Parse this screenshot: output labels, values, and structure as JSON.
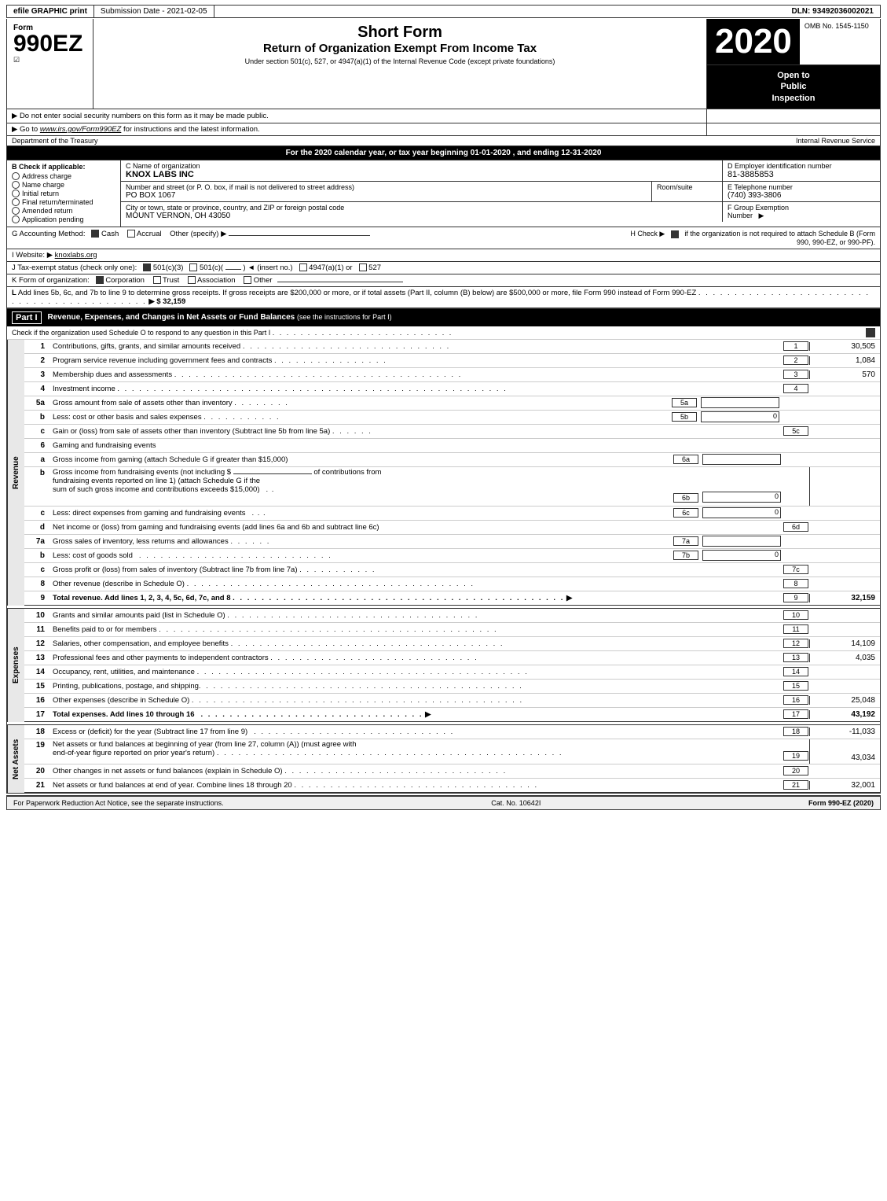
{
  "topBar": {
    "efile": "efile GRAPHIC print",
    "submission": "Submission Date - 2021-02-05",
    "dln": "DLN: 93492036002021"
  },
  "header": {
    "formLabel": "Form",
    "formNumber": "990EZ",
    "titleMain": "Short Form",
    "titleSub": "Return of Organization Exempt From Income Tax",
    "titleUnder": "Under section 501(c), 527, or 4947(a)(1) of the Internal Revenue Code (except private foundations)",
    "notice1": "▶ Do not enter social security numbers on this form as it may be made public.",
    "notice2": "▶ Go to www.irs.gov/Form990EZ for instructions and the latest information.",
    "year": "2020",
    "ombLabel": "OMB No. 1545-1150",
    "openToPublic": "Open to Public Inspection"
  },
  "deptRow": {
    "dept": "Department of the Treasury",
    "irs": "Internal Revenue Service"
  },
  "taxYearRow": "For the 2020 calendar year, or tax year beginning 01-01-2020 , and ending 12-31-2020",
  "checkApplicable": {
    "label": "B Check if applicable:",
    "items": [
      {
        "id": "address-change",
        "text": "Address charge",
        "checked": false
      },
      {
        "id": "name-change",
        "text": "Name charge",
        "checked": false
      },
      {
        "id": "initial-return",
        "text": "Initial return",
        "checked": false
      },
      {
        "id": "final-return",
        "text": "Final return/terminated",
        "checked": false
      },
      {
        "id": "amended",
        "text": "Amended return",
        "checked": false
      },
      {
        "id": "app-pending",
        "text": "Application pending",
        "checked": false
      }
    ]
  },
  "orgInfo": {
    "nameLabel": "C Name of organization",
    "nameValue": "KNOX LABS INC",
    "einLabel": "D Employer identification number",
    "einValue": "81-3885853",
    "addressLabel": "Number and street (or P. O. box, if mail is not delivered to street address)",
    "addressValue": "PO BOX 1067",
    "roomLabel": "Room/suite",
    "roomValue": "",
    "phoneLabel": "E Telephone number",
    "phoneValue": "(740) 393-3806",
    "cityLabel": "City or town, state or province, country, and ZIP or foreign postal code",
    "cityValue": "MOUNT VERNON, OH  43050",
    "groupLabel": "F Group Exemption Number",
    "groupArrow": "▶"
  },
  "accounting": {
    "lineG": "G Accounting Method:",
    "cash": "Cash",
    "cashChecked": true,
    "accrual": "Accrual",
    "accrualChecked": false,
    "other": "Other (specify) ▶",
    "lineH": "H Check ▶",
    "hText": "if the organization is not required to attach Schedule B (Form 990, 990-EZ, or 990-PF).",
    "hChecked": true
  },
  "website": {
    "label": "I Website: ▶",
    "value": "knoxlabs.org"
  },
  "taxExempt": {
    "label": "J Tax-exempt status (check only one):",
    "options": [
      {
        "text": "501(c)(3)",
        "checked": true
      },
      {
        "text": "501(c)(",
        "checked": false
      },
      {
        "text": ") ◄ (insert no.)",
        "checked": false
      },
      {
        "text": "4947(a)(1) or",
        "checked": false
      },
      {
        "text": "527",
        "checked": false
      }
    ]
  },
  "formOrg": {
    "label": "K Form of organization:",
    "options": [
      {
        "text": "Corporation",
        "checked": true
      },
      {
        "text": "Trust",
        "checked": false
      },
      {
        "text": "Association",
        "checked": false
      },
      {
        "text": "Other",
        "checked": false
      }
    ]
  },
  "lineL": {
    "text": "L Add lines 5b, 6c, and 7b to line 9 to determine gross receipts. If gross receipts are $200,000 or more, or if total assets (Part II, column (B) below) are $500,000 or more, file Form 990 instead of Form 990-EZ",
    "dots": ". . . . . . . . . . . . . . . . . . . . . . . . . . . . . . . . . . . . . . . . . .",
    "arrowAmount": "▶ $ 32,159"
  },
  "partI": {
    "label": "Part I",
    "title": "Revenue, Expenses, and Changes in Net Assets or Fund Balances",
    "titleNote": "(see the instructions for Part I)",
    "scheduleONote": "Check if the organization used Schedule O to respond to any question in this Part I",
    "scheduleODots": ". . . . . . . . . . . . . . . . . . . . . . . . . .",
    "scheduleOChecked": true,
    "rows": [
      {
        "num": "1",
        "desc": "Contributions, gifts, grants, and similar amounts received",
        "dots": ". . . . . . . . . . . . . . . . . . . . . . . . . . . . .",
        "ref": "1",
        "amount": "30,505"
      },
      {
        "num": "2",
        "desc": "Program service revenue including government fees and contracts",
        "dots": ". . . . . . . . . . . . . . . .",
        "ref": "2",
        "amount": "1,084"
      },
      {
        "num": "3",
        "desc": "Membership dues and assessments",
        "dots": ". . . . . . . . . . . . . . . . . . . . . . . . . . . . . . . . . . . . . . . .",
        "ref": "3",
        "amount": "570"
      },
      {
        "num": "4",
        "desc": "Investment income",
        "dots": ". . . . . . . . . . . . . . . . . . . . . . . . . . . . . . . . . . . . . . . . . . . . . . . . . . . . . .",
        "ref": "4",
        "amount": ""
      },
      {
        "num": "5a",
        "desc": "Gross amount from sale of assets other than inventory",
        "dots": ". . . . . . . .",
        "subLabel": "5a",
        "subAmount": "",
        "ref": "",
        "amount": ""
      },
      {
        "num": "b",
        "desc": "Less: cost or other basis and sales expenses",
        "dots": ". . . . . . . . . . .",
        "subLabel": "5b",
        "subAmount": "0",
        "ref": "",
        "amount": ""
      },
      {
        "num": "c",
        "desc": "Gain or (loss) from sale of assets other than inventory (Subtract line 5b from line 5a)",
        "dots": ". . . . . .",
        "ref": "5c",
        "amount": ""
      }
    ],
    "line6": {
      "num": "6",
      "desc": "Gaming and fundraising events"
    },
    "line6a": {
      "num": "a",
      "desc": "Gross income from gaming (attach Schedule G if greater than $15,000)",
      "subLabel": "6a",
      "subAmount": ""
    },
    "line6b": {
      "num": "b",
      "desc1": "Gross income from fundraising events (not including $",
      "blank": "",
      "desc2": "of contributions from",
      "desc3": "fundraising events reported on line 1) (attach Schedule G if the",
      "desc4": "sum of such gross income and contributions exceeds $15,000)",
      "dots": ". .",
      "subLabel": "6b",
      "subAmount": "0"
    },
    "line6c": {
      "num": "c",
      "desc": "Less: direct expenses from gaming and fundraising events",
      "dots": ". . .",
      "subLabel": "6c",
      "subAmount": "0"
    },
    "line6d": {
      "num": "d",
      "desc": "Net income or (loss) from gaming and fundraising events (add lines 6a and 6b and subtract line 6c)",
      "ref": "6d",
      "amount": ""
    },
    "line7a": {
      "num": "7a",
      "desc": "Gross sales of inventory, less returns and allowances",
      "dots": ". . . . . .",
      "subLabel": "7a",
      "subAmount": ""
    },
    "line7b": {
      "num": "b",
      "desc": "Less: cost of goods sold",
      "dots": ". . . . . . . . . . . . . . . . . . . . . . . . . . .",
      "subLabel": "7b",
      "subAmount": "0"
    },
    "line7c": {
      "num": "c",
      "desc": "Gross profit or (loss) from sales of inventory (Subtract line 7b from line 7a)",
      "dots": ". . . . . . . . . . .",
      "ref": "7c",
      "amount": ""
    },
    "line8": {
      "num": "8",
      "desc": "Other revenue (describe in Schedule O)",
      "dots": ". . . . . . . . . . . . . . . . . . . . . . . . . . . . . . . . . . . . . . . .",
      "ref": "8",
      "amount": ""
    },
    "line9": {
      "num": "9",
      "desc": "Total revenue. Add lines 1, 2, 3, 4, 5c, 6d, 7c, and 8",
      "dots": ". . . . . . . . . . . . . . . . . . . . . . . . . . . . . . . . . . . . . . . . . . . . . .",
      "arrow": "▶",
      "ref": "9",
      "amount": "32,159"
    }
  },
  "partIExpenses": {
    "rows": [
      {
        "num": "10",
        "desc": "Grants and similar amounts paid (list in Schedule O)",
        "dots": ". . . . . . . . . . . . . . . . . . . . . . . . . . . . . . . . . . .",
        "ref": "10",
        "amount": ""
      },
      {
        "num": "11",
        "desc": "Benefits paid to or for members",
        "dots": ". . . . . . . . . . . . . . . . . . . . . . . . . . . . . . . . . . . . . . . . . . . . . . .",
        "ref": "11",
        "amount": ""
      },
      {
        "num": "12",
        "desc": "Salaries, other compensation, and employee benefits",
        "dots": ". . . . . . . . . . . . . . . . . . . . . . . . . . . . . . . . . . . . . .",
        "ref": "12",
        "amount": "14,109"
      },
      {
        "num": "13",
        "desc": "Professional fees and other payments to independent contractors",
        "dots": ". . . . . . . . . . . . . . . . . . . . . . . . . . . . .",
        "ref": "13",
        "amount": "4,035"
      },
      {
        "num": "14",
        "desc": "Occupancy, rent, utilities, and maintenance",
        "dots": ". . . . . . . . . . . . . . . . . . . . . . . . . . . . . . . . . . . . . . . . . . . . . .",
        "ref": "14",
        "amount": ""
      },
      {
        "num": "15",
        "desc": "Printing, publications, postage, and shipping",
        "dots": ". . . . . . . . . . . . . . . . . . . . . . . . . . . . . . . . . . . . . . . . . . . . .",
        "ref": "15",
        "amount": ""
      },
      {
        "num": "16",
        "desc": "Other expenses (describe in Schedule O)",
        "dots": ". . . . . . . . . . . . . . . . . . . . . . . . . . . . . . . . . . . . . . . . . . . . . .",
        "ref": "16",
        "amount": "25,048"
      },
      {
        "num": "17",
        "desc": "Total expenses. Add lines 10 through 16",
        "dots": ". . . . . . . . . . . . . . . . . . . . . . . . . . . . . . .",
        "arrow": "▶",
        "ref": "17",
        "amount": "43,192",
        "bold": true
      }
    ]
  },
  "partINetAssets": {
    "rows": [
      {
        "num": "18",
        "desc": "Excess or (deficit) for the year (Subtract line 17 from line 9)",
        "dots": ". . . . . . . . . . . . . . . . . . . . . . . . . . . .",
        "ref": "18",
        "amount": "-11,033"
      },
      {
        "num": "19",
        "desc": "Net assets or fund balances at beginning of year (from line 27, column (A)) (must agree with",
        "dots": "",
        "ref": "",
        "amount": ""
      },
      {
        "num": "",
        "desc": "end-of-year figure reported on prior year's return)",
        "dots": ". . . . . . . . . . . . . . . . . . . . . . . . . . . . . . . . . . . . . . . . . . . . . . . .",
        "ref": "19",
        "amount": "43,034"
      },
      {
        "num": "20",
        "desc": "Other changes in net assets or fund balances (explain in Schedule O)",
        "dots": ". . . . . . . . . . . . . . . . . . . . . . . . . . . . . . .",
        "ref": "20",
        "amount": ""
      },
      {
        "num": "21",
        "desc": "Net assets or fund balances at end of year. Combine lines 18 through 20",
        "dots": ". . . . . . . . . . . . . . . . . . . . . . . . . . . . . . . . . . .",
        "ref": "21",
        "amount": "32,001"
      }
    ]
  },
  "footer": {
    "paperwork": "For Paperwork Reduction Act Notice, see the separate instructions.",
    "catNo": "Cat. No. 10642I",
    "formRef": "Form 990-EZ (2020)"
  }
}
